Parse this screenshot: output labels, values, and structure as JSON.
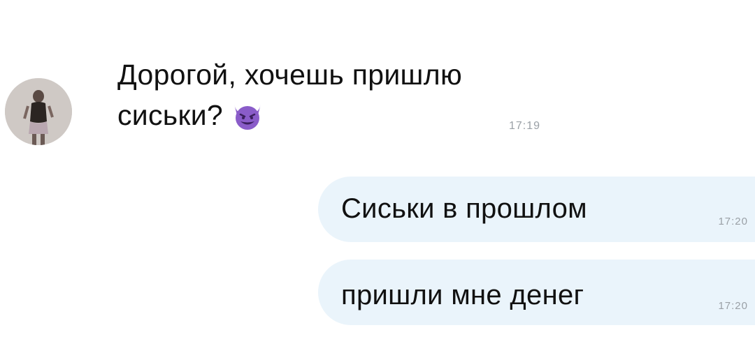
{
  "incoming": {
    "line1": "Дорогой, хочешь пришлю",
    "line2": "сиськи?",
    "emoji": "smiling-face-with-horns-icon",
    "time": "17:19"
  },
  "outgoing": [
    {
      "text": "Сиськи в прошлом",
      "time": "17:20"
    },
    {
      "text": "пришли мне денег",
      "time": "17:20"
    }
  ],
  "colors": {
    "outgoing_bubble": "#eaf4fb",
    "timestamp": "#9aa0a6",
    "emoji_purple": "#8a5cc9"
  }
}
